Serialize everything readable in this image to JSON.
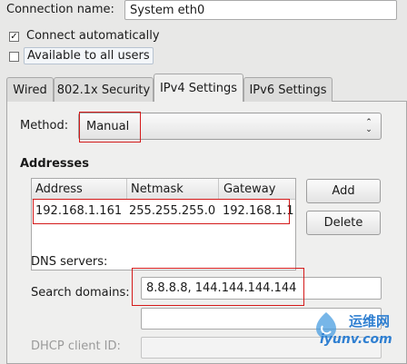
{
  "connection": {
    "name_label": "Connection name:",
    "name_value": "System eth0"
  },
  "options": {
    "connect_auto": {
      "label": "Connect automatically",
      "checked": true,
      "mark": "✓"
    },
    "all_users": {
      "label": "Available to all users",
      "checked": false
    }
  },
  "tabs": [
    "Wired",
    "802.1x Security",
    "IPv4 Settings",
    "IPv6 Settings"
  ],
  "active_tab": "IPv4 Settings",
  "method": {
    "label": "Method:",
    "value": "Manual",
    "arrows": "⌃⌄"
  },
  "addresses": {
    "title": "Addresses",
    "columns": [
      "Address",
      "Netmask",
      "Gateway"
    ],
    "rows": [
      {
        "address": "192.168.1.161",
        "netmask": "255.255.255.0",
        "gateway": "192.168.1.1"
      }
    ],
    "add_button": "Add",
    "delete_button": "Delete"
  },
  "dns": {
    "label": "DNS servers:",
    "value": "8.8.8.8, 144.144.144.144"
  },
  "search_domains": {
    "label": "Search domains:",
    "value": ""
  },
  "dhcp_client_id": {
    "label": "DHCP client ID:"
  },
  "watermark": {
    "text_cn": "运维网",
    "text_url": "iyunv.com"
  },
  "colors": {
    "highlight_red": "#d41a1a",
    "watermark_blue": "#2f7fd1",
    "window_bg": "#e8e8e7"
  }
}
